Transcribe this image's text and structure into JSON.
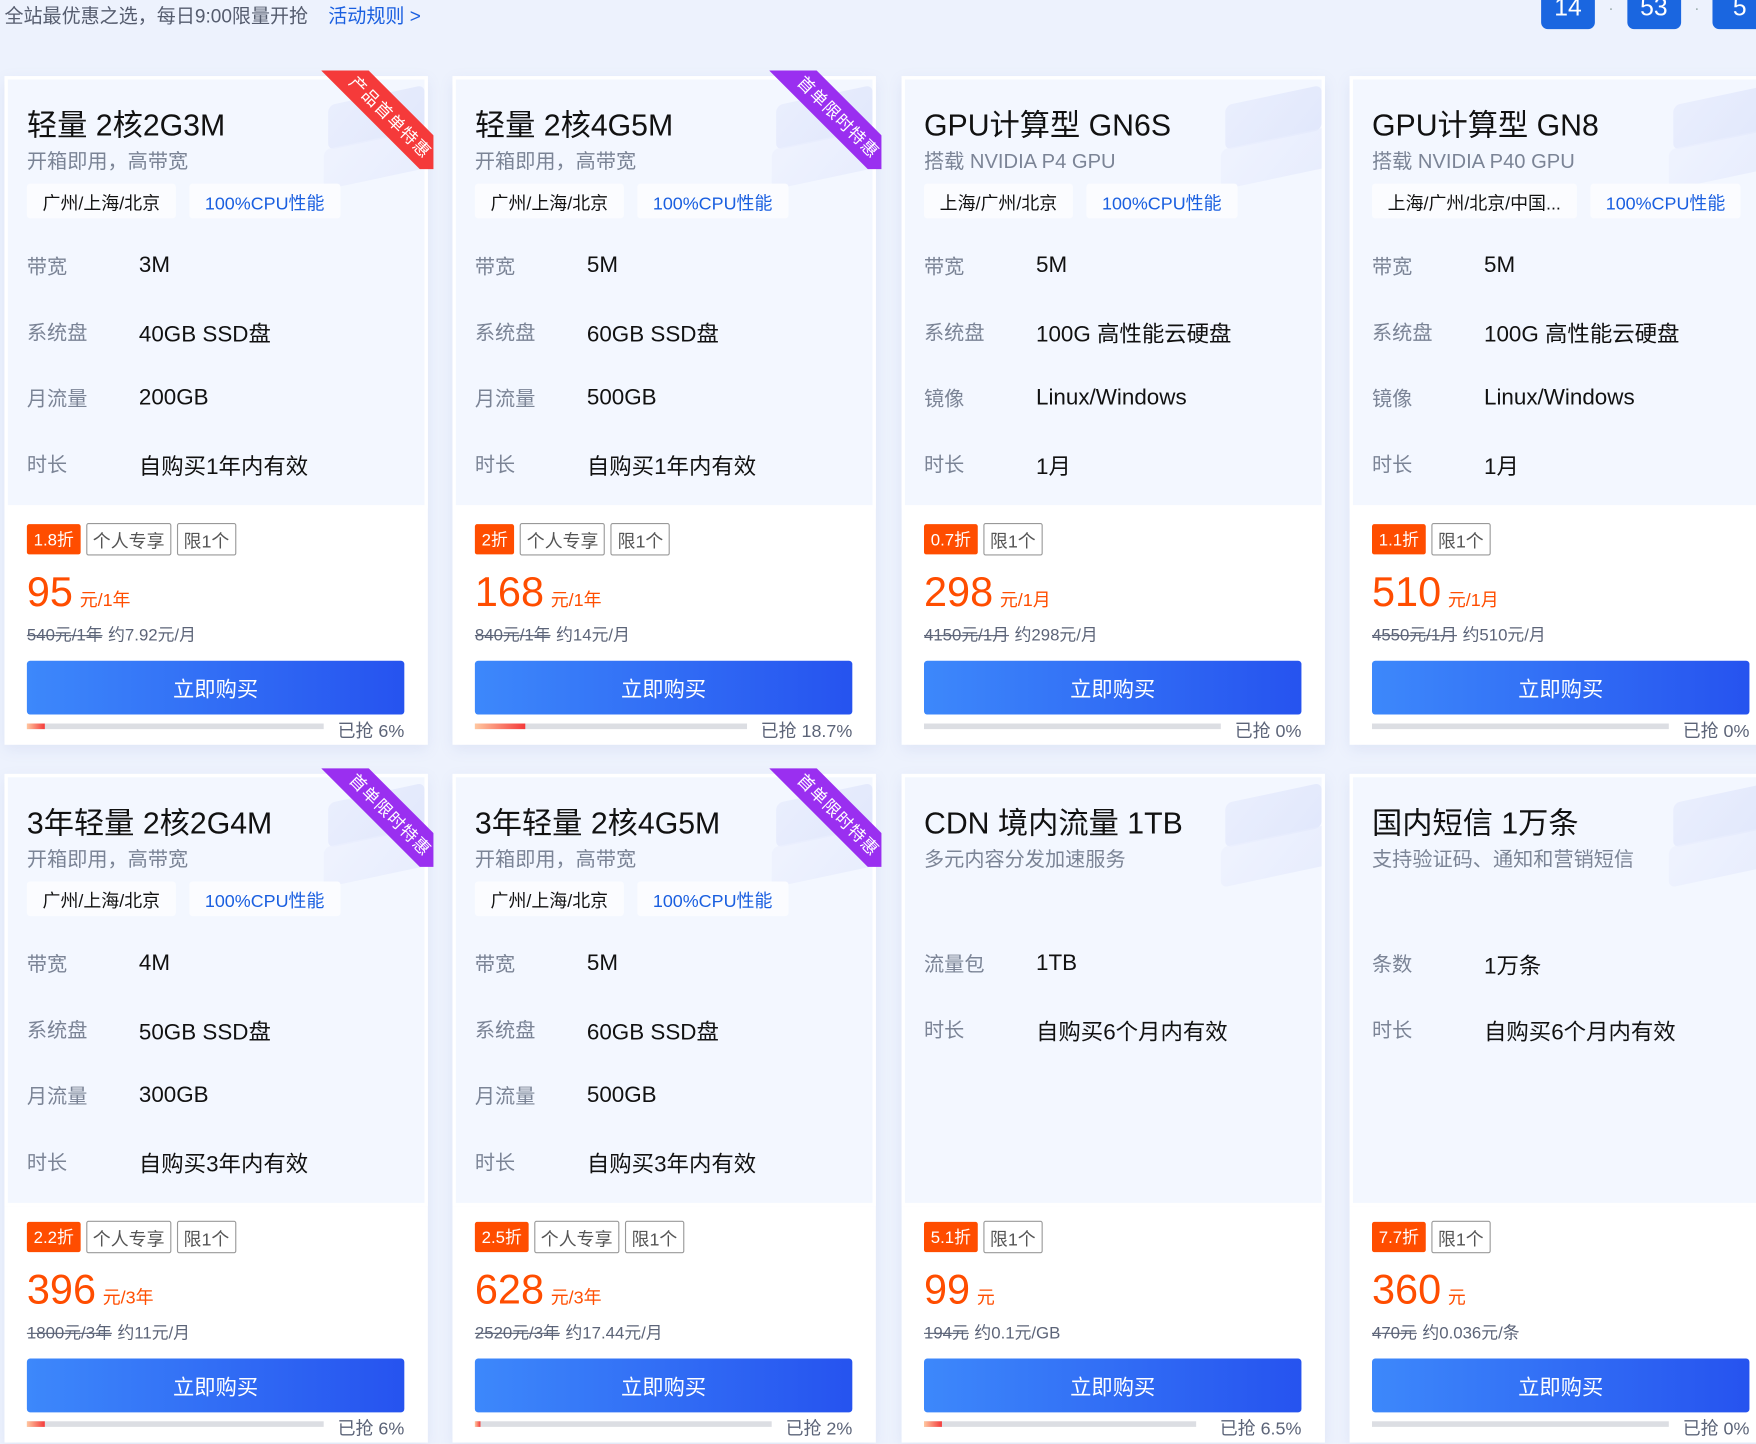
{
  "header": {
    "slogan": "全站最优惠之选，每日9:00限量开抢",
    "rules_link": "活动规则 >",
    "countdown": [
      "14",
      "53",
      "5"
    ]
  },
  "colors": {
    "accent": "#1a5fe0",
    "price": "#ff4d00",
    "ribbon_red": "#f53a3a",
    "ribbon_purple": "#9a2ff0"
  },
  "cards": [
    {
      "title": "轻量 2核2G3M",
      "subtitle": "开箱即用，高带宽",
      "tags": [
        "广州/上海/北京",
        "100%CPU性能"
      ],
      "specs": [
        {
          "k": "带宽",
          "v": "3M"
        },
        {
          "k": "系统盘",
          "v": "40GB SSD盘"
        },
        {
          "k": "月流量",
          "v": "200GB"
        },
        {
          "k": "时长",
          "v": "自购买1年内有效"
        }
      ],
      "discount": "1.8折",
      "badges": [
        "个人专享",
        "限1个"
      ],
      "price": "95",
      "unit": "元/1年",
      "original": "540元/1年",
      "monthly": "约7.92元/月",
      "buy": "立即购买",
      "sold_label": "已抢 6%",
      "sold": 6,
      "ribbon": "产品首单特惠",
      "ribbon_color": "red"
    },
    {
      "title": "轻量 2核4G5M",
      "subtitle": "开箱即用，高带宽",
      "tags": [
        "广州/上海/北京",
        "100%CPU性能"
      ],
      "specs": [
        {
          "k": "带宽",
          "v": "5M"
        },
        {
          "k": "系统盘",
          "v": "60GB SSD盘"
        },
        {
          "k": "月流量",
          "v": "500GB"
        },
        {
          "k": "时长",
          "v": "自购买1年内有效"
        }
      ],
      "discount": "2折",
      "badges": [
        "个人专享",
        "限1个"
      ],
      "price": "168",
      "unit": "元/1年",
      "original": "840元/1年",
      "monthly": "约14元/月",
      "buy": "立即购买",
      "sold_label": "已抢 18.7%",
      "sold": 18.7,
      "ribbon": "首单限时特惠",
      "ribbon_color": "purple"
    },
    {
      "title": "GPU计算型 GN6S",
      "subtitle": "搭载 NVIDIA P4 GPU",
      "tags": [
        "上海/广州/北京",
        "100%CPU性能"
      ],
      "specs": [
        {
          "k": "带宽",
          "v": "5M"
        },
        {
          "k": "系统盘",
          "v": "100G 高性能云硬盘"
        },
        {
          "k": "镜像",
          "v": "Linux/Windows"
        },
        {
          "k": "时长",
          "v": "1月"
        }
      ],
      "discount": "0.7折",
      "badges": [
        "限1个"
      ],
      "price": "298",
      "unit": "元/1月",
      "original": "4150元/1月",
      "monthly": "约298元/月",
      "buy": "立即购买",
      "sold_label": "已抢 0%",
      "sold": 0,
      "ribbon": "",
      "ribbon_color": ""
    },
    {
      "title": "GPU计算型 GN8",
      "subtitle": "搭载 NVIDIA P40 GPU",
      "tags": [
        "上海/广州/北京/中国...",
        "100%CPU性能"
      ],
      "specs": [
        {
          "k": "带宽",
          "v": "5M"
        },
        {
          "k": "系统盘",
          "v": "100G 高性能云硬盘"
        },
        {
          "k": "镜像",
          "v": "Linux/Windows"
        },
        {
          "k": "时长",
          "v": "1月"
        }
      ],
      "discount": "1.1折",
      "badges": [
        "限1个"
      ],
      "price": "510",
      "unit": "元/1月",
      "original": "4550元/1月",
      "monthly": "约510元/月",
      "buy": "立即购买",
      "sold_label": "已抢 0%",
      "sold": 0,
      "ribbon": "",
      "ribbon_color": ""
    },
    {
      "title": "3年轻量 2核2G4M",
      "subtitle": "开箱即用，高带宽",
      "tags": [
        "广州/上海/北京",
        "100%CPU性能"
      ],
      "specs": [
        {
          "k": "带宽",
          "v": "4M"
        },
        {
          "k": "系统盘",
          "v": "50GB SSD盘"
        },
        {
          "k": "月流量",
          "v": "300GB"
        },
        {
          "k": "时长",
          "v": "自购买3年内有效"
        }
      ],
      "discount": "2.2折",
      "badges": [
        "个人专享",
        "限1个"
      ],
      "price": "396",
      "unit": "元/3年",
      "original": "1800元/3年",
      "monthly": "约11元/月",
      "buy": "立即购买",
      "sold_label": "已抢 6%",
      "sold": 6,
      "ribbon": "首单限时特惠",
      "ribbon_color": "purple"
    },
    {
      "title": "3年轻量 2核4G5M",
      "subtitle": "开箱即用，高带宽",
      "tags": [
        "广州/上海/北京",
        "100%CPU性能"
      ],
      "specs": [
        {
          "k": "带宽",
          "v": "5M"
        },
        {
          "k": "系统盘",
          "v": "60GB SSD盘"
        },
        {
          "k": "月流量",
          "v": "500GB"
        },
        {
          "k": "时长",
          "v": "自购买3年内有效"
        }
      ],
      "discount": "2.5折",
      "badges": [
        "个人专享",
        "限1个"
      ],
      "price": "628",
      "unit": "元/3年",
      "original": "2520元/3年",
      "monthly": "约17.44元/月",
      "buy": "立即购买",
      "sold_label": "已抢 2%",
      "sold": 2,
      "ribbon": "首单限时特惠",
      "ribbon_color": "purple"
    },
    {
      "title": "CDN 境内流量 1TB",
      "subtitle": "多元内容分发加速服务",
      "tags": [],
      "specs": [
        {
          "k": "流量包",
          "v": "1TB"
        },
        {
          "k": "时长",
          "v": "自购买6个月内有效"
        }
      ],
      "discount": "5.1折",
      "badges": [
        "限1个"
      ],
      "price": "99",
      "unit": "元",
      "original": "194元",
      "monthly": "约0.1元/GB",
      "buy": "立即购买",
      "sold_label": "已抢 6.5%",
      "sold": 6.5,
      "ribbon": "",
      "ribbon_color": ""
    },
    {
      "title": "国内短信 1万条",
      "subtitle": "支持验证码、通知和营销短信",
      "tags": [],
      "specs": [
        {
          "k": "条数",
          "v": "1万条"
        },
        {
          "k": "时长",
          "v": "自购买6个月内有效"
        }
      ],
      "discount": "7.7折",
      "badges": [
        "限1个"
      ],
      "price": "360",
      "unit": "元",
      "original": "470元",
      "monthly": "约0.036元/条",
      "buy": "立即购买",
      "sold_label": "已抢 0%",
      "sold": 0,
      "ribbon": "",
      "ribbon_color": ""
    }
  ]
}
